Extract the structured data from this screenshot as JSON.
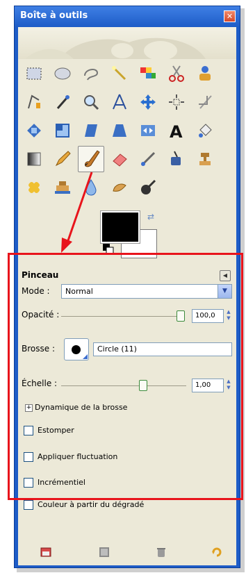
{
  "window": {
    "title": "Boîte à outils",
    "close_label": "✕"
  },
  "tools": [
    "rect-select",
    "ellipse-select",
    "free-select",
    "fuzzy-select",
    "color-select",
    "scissors-select",
    "foreground-select",
    "paths",
    "color-picker",
    "zoom",
    "measure",
    "move",
    "align",
    "crop",
    "rotate",
    "scale",
    "shear",
    "perspective",
    "flip",
    "text",
    "cage",
    "blend",
    "pencil",
    "paintbrush",
    "eraser",
    "airbrush",
    "ink",
    "clone",
    "heal",
    "perspective-clone",
    "blur",
    "smudge",
    "dodge-burn"
  ],
  "colors": {
    "foreground": "#000000",
    "background": "#ffffff",
    "accent": "#e8141c",
    "titlebar": "#1d5cc7"
  },
  "options": {
    "title": "Pinceau",
    "mode_label": "Mode :",
    "mode_value": "Normal",
    "opacity_label": "Opacité :",
    "opacity_value": "100,0",
    "opacity_fraction": 1.0,
    "brush_label": "Brosse :",
    "brush_name": "Circle (11)",
    "scale_label": "Échelle :",
    "scale_value": "1,00",
    "dynamics_label": "Dynamique de la brosse",
    "checkboxes": [
      "Estomper",
      "Appliquer fluctuation",
      "Incrémentiel",
      "Couleur à partir du dégradé"
    ]
  },
  "bottom_icons": [
    "save-tool-options-icon",
    "restore-tool-options-icon",
    "delete-tool-options-icon",
    "reset-tool-options-icon"
  ]
}
